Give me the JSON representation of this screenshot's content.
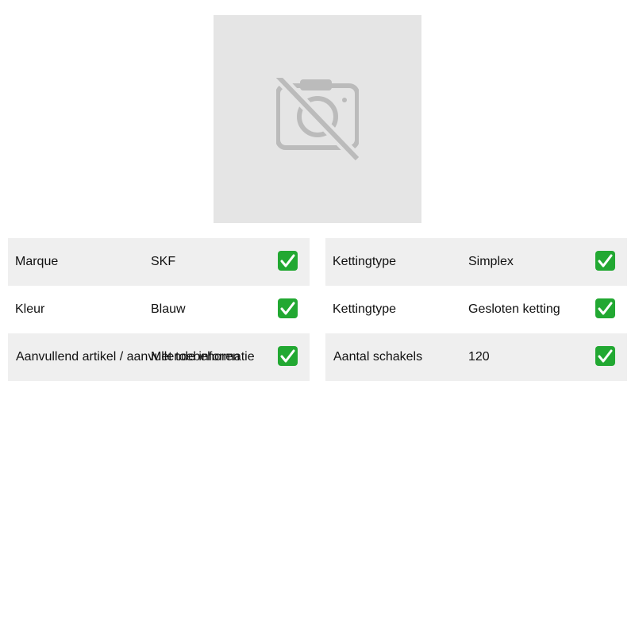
{
  "product": {
    "image_icon": "no-photo-camera-icon"
  },
  "specs_left": [
    {
      "label": "Marque",
      "value": "SKF",
      "status_icon": "check-icon"
    },
    {
      "label": "Kleur",
      "value": "Blauw",
      "status_icon": "check-icon"
    },
    {
      "label": "Aanvullend artikel / aanvullende informatie",
      "value": "Met toebehoren",
      "status_icon": "check-icon"
    }
  ],
  "specs_right": [
    {
      "label": "Kettingtype",
      "value": "Simplex",
      "status_icon": "check-icon"
    },
    {
      "label": "Kettingtype",
      "value": "Gesloten ketting",
      "status_icon": "check-icon"
    },
    {
      "label": "Aantal schakels",
      "value": "120",
      "status_icon": "check-icon"
    }
  ],
  "colors": {
    "placeholder_bg": "#e5e5e5",
    "row_shade": "#efefef",
    "check_green": "#22a832"
  }
}
